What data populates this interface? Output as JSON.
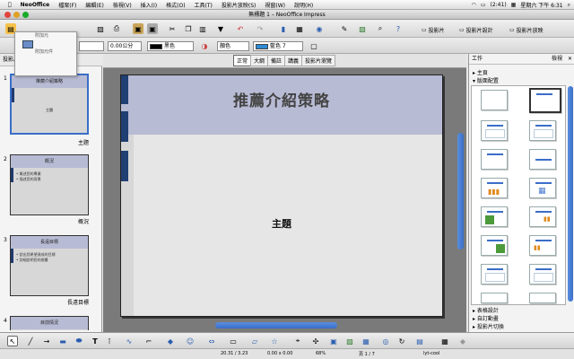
{
  "menubar": {
    "app": "NeoOffice",
    "items": [
      "檔案(F)",
      "編輯(E)",
      "檢視(V)",
      "插入(I)",
      "格式(O)",
      "工具(T)",
      "投影片放映(S)",
      "視窗(W)",
      "說明(H)"
    ],
    "battery": "(2:41)",
    "datetime": "星期六 下午 6:31"
  },
  "window": {
    "title": "無標題 1 – NeoOffice Impress"
  },
  "toolbar": {
    "slide_label": "投影片",
    "slide_design_label": "投影片設計",
    "slide_show_label": "投影片放映",
    "line_width": "0.00公分",
    "line_color": "黑色",
    "area_mode": "顏色",
    "area_color": "藍色 7",
    "colors": {
      "line": "#000000",
      "area": "#2e8bd6"
    }
  },
  "popup": {
    "row1": "附加元",
    "row3": "附加元件"
  },
  "left_pane": {
    "header": "投影片",
    "slides": [
      {
        "num": "1",
        "title": "推薦介紹策略",
        "body": [
          "主題"
        ],
        "caption": "主題"
      },
      {
        "num": "2",
        "title": "概況",
        "body": [
          "• 概述您的專業",
          "• 描述您的背景"
        ],
        "caption": "概況"
      },
      {
        "num": "3",
        "title": "長遠目標",
        "body": [
          "• 說出您希望達成的目標",
          "• 詳細說明您的規畫"
        ],
        "caption": "長遠目標"
      },
      {
        "num": "4",
        "title": "目前情況",
        "body": [],
        "caption": ""
      }
    ]
  },
  "main": {
    "tabs": [
      "正常",
      "大綱",
      "備註",
      "講義",
      "投影片瀏覽"
    ],
    "active_tab": "正常",
    "slide": {
      "title": "推薦介紹策略",
      "subtitle": "主題",
      "colors": {
        "header": "#b8bbd4",
        "accent": "#203f72",
        "body": "#e6e6e6"
      }
    }
  },
  "right_pane": {
    "header": "工作",
    "view_label": "檢視",
    "sections_top": [
      "主頁",
      "版面配置"
    ],
    "sections_bottom": [
      "表格設計",
      "自訂動畫",
      "投影片切換"
    ]
  },
  "status": {
    "position": "20.31 / 3.23",
    "size": "0.00 x 0.00",
    "zoom": "68%",
    "page": "頁 1 / 7",
    "layout": "lyt-cool"
  }
}
